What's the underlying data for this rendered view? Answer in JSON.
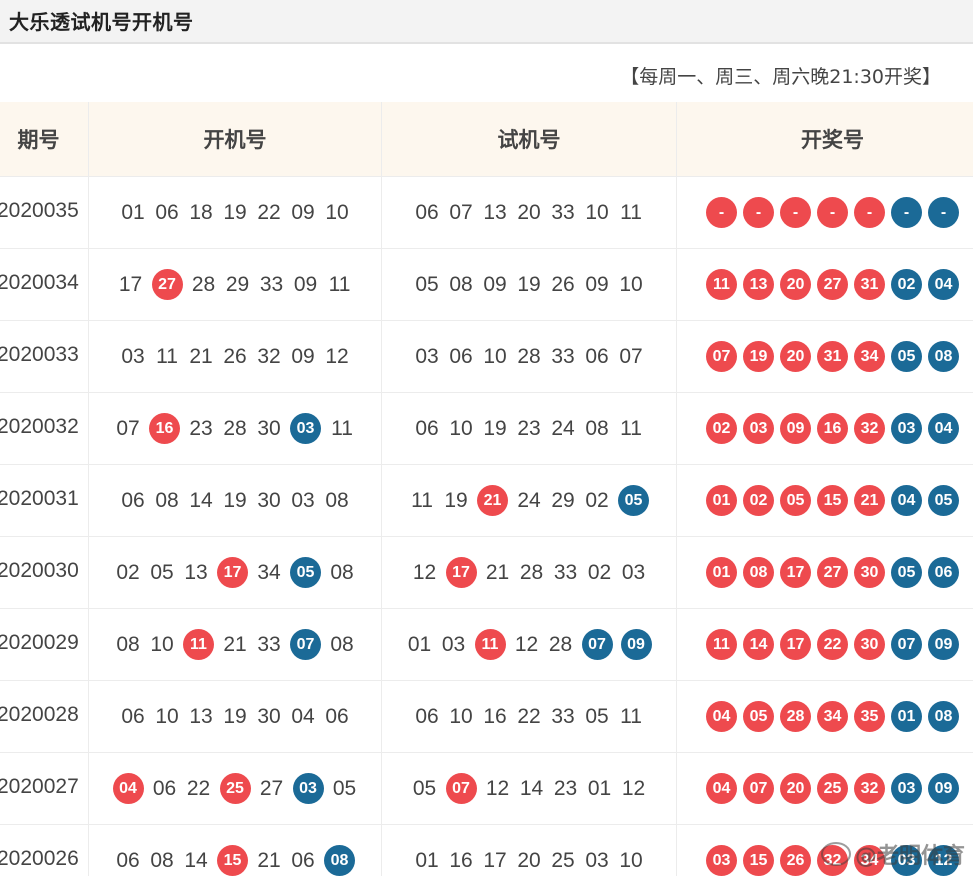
{
  "page": {
    "title": "大乐透试机号开机号",
    "schedule": "【每周一、周三、周六晚21:30开奖】",
    "watermark": "@老明体育"
  },
  "colors": {
    "red_ball": "#ee4a4e",
    "blue_ball": "#1b6a97",
    "header_bg": "#fdf7ee"
  },
  "table": {
    "headers": {
      "issue": "期号",
      "open": "开机号",
      "trial": "试机号",
      "draw": "开奖号"
    },
    "rows": [
      {
        "issue": "2020035",
        "open": [
          {
            "n": "01"
          },
          {
            "n": "06"
          },
          {
            "n": "18"
          },
          {
            "n": "19"
          },
          {
            "n": "22"
          },
          {
            "n": "09"
          },
          {
            "n": "10"
          }
        ],
        "trial": [
          {
            "n": "06"
          },
          {
            "n": "07"
          },
          {
            "n": "13"
          },
          {
            "n": "20"
          },
          {
            "n": "33"
          },
          {
            "n": "10"
          },
          {
            "n": "11"
          }
        ],
        "draw": [
          {
            "n": "-",
            "c": "red"
          },
          {
            "n": "-",
            "c": "red"
          },
          {
            "n": "-",
            "c": "red"
          },
          {
            "n": "-",
            "c": "red"
          },
          {
            "n": "-",
            "c": "red"
          },
          {
            "n": "-",
            "c": "blue"
          },
          {
            "n": "-",
            "c": "blue"
          }
        ]
      },
      {
        "issue": "2020034",
        "open": [
          {
            "n": "17"
          },
          {
            "n": "27",
            "c": "red"
          },
          {
            "n": "28"
          },
          {
            "n": "29"
          },
          {
            "n": "33"
          },
          {
            "n": "09"
          },
          {
            "n": "11"
          }
        ],
        "trial": [
          {
            "n": "05"
          },
          {
            "n": "08"
          },
          {
            "n": "09"
          },
          {
            "n": "19"
          },
          {
            "n": "26"
          },
          {
            "n": "09"
          },
          {
            "n": "10"
          }
        ],
        "draw": [
          {
            "n": "11",
            "c": "red"
          },
          {
            "n": "13",
            "c": "red"
          },
          {
            "n": "20",
            "c": "red"
          },
          {
            "n": "27",
            "c": "red"
          },
          {
            "n": "31",
            "c": "red"
          },
          {
            "n": "02",
            "c": "blue"
          },
          {
            "n": "04",
            "c": "blue"
          }
        ]
      },
      {
        "issue": "2020033",
        "open": [
          {
            "n": "03"
          },
          {
            "n": "11"
          },
          {
            "n": "21"
          },
          {
            "n": "26"
          },
          {
            "n": "32"
          },
          {
            "n": "09"
          },
          {
            "n": "12"
          }
        ],
        "trial": [
          {
            "n": "03"
          },
          {
            "n": "06"
          },
          {
            "n": "10"
          },
          {
            "n": "28"
          },
          {
            "n": "33"
          },
          {
            "n": "06"
          },
          {
            "n": "07"
          }
        ],
        "draw": [
          {
            "n": "07",
            "c": "red"
          },
          {
            "n": "19",
            "c": "red"
          },
          {
            "n": "20",
            "c": "red"
          },
          {
            "n": "31",
            "c": "red"
          },
          {
            "n": "34",
            "c": "red"
          },
          {
            "n": "05",
            "c": "blue"
          },
          {
            "n": "08",
            "c": "blue"
          }
        ]
      },
      {
        "issue": "2020032",
        "open": [
          {
            "n": "07"
          },
          {
            "n": "16",
            "c": "red"
          },
          {
            "n": "23"
          },
          {
            "n": "28"
          },
          {
            "n": "30"
          },
          {
            "n": "03",
            "c": "blue"
          },
          {
            "n": "11"
          }
        ],
        "trial": [
          {
            "n": "06"
          },
          {
            "n": "10"
          },
          {
            "n": "19"
          },
          {
            "n": "23"
          },
          {
            "n": "24"
          },
          {
            "n": "08"
          },
          {
            "n": "11"
          }
        ],
        "draw": [
          {
            "n": "02",
            "c": "red"
          },
          {
            "n": "03",
            "c": "red"
          },
          {
            "n": "09",
            "c": "red"
          },
          {
            "n": "16",
            "c": "red"
          },
          {
            "n": "32",
            "c": "red"
          },
          {
            "n": "03",
            "c": "blue"
          },
          {
            "n": "04",
            "c": "blue"
          }
        ]
      },
      {
        "issue": "2020031",
        "open": [
          {
            "n": "06"
          },
          {
            "n": "08"
          },
          {
            "n": "14"
          },
          {
            "n": "19"
          },
          {
            "n": "30"
          },
          {
            "n": "03"
          },
          {
            "n": "08"
          }
        ],
        "trial": [
          {
            "n": "11"
          },
          {
            "n": "19"
          },
          {
            "n": "21",
            "c": "red"
          },
          {
            "n": "24"
          },
          {
            "n": "29"
          },
          {
            "n": "02"
          },
          {
            "n": "05",
            "c": "blue"
          }
        ],
        "draw": [
          {
            "n": "01",
            "c": "red"
          },
          {
            "n": "02",
            "c": "red"
          },
          {
            "n": "05",
            "c": "red"
          },
          {
            "n": "15",
            "c": "red"
          },
          {
            "n": "21",
            "c": "red"
          },
          {
            "n": "04",
            "c": "blue"
          },
          {
            "n": "05",
            "c": "blue"
          }
        ]
      },
      {
        "issue": "2020030",
        "open": [
          {
            "n": "02"
          },
          {
            "n": "05"
          },
          {
            "n": "13"
          },
          {
            "n": "17",
            "c": "red"
          },
          {
            "n": "34"
          },
          {
            "n": "05",
            "c": "blue"
          },
          {
            "n": "08"
          }
        ],
        "trial": [
          {
            "n": "12"
          },
          {
            "n": "17",
            "c": "red"
          },
          {
            "n": "21"
          },
          {
            "n": "28"
          },
          {
            "n": "33"
          },
          {
            "n": "02"
          },
          {
            "n": "03"
          }
        ],
        "draw": [
          {
            "n": "01",
            "c": "red"
          },
          {
            "n": "08",
            "c": "red"
          },
          {
            "n": "17",
            "c": "red"
          },
          {
            "n": "27",
            "c": "red"
          },
          {
            "n": "30",
            "c": "red"
          },
          {
            "n": "05",
            "c": "blue"
          },
          {
            "n": "06",
            "c": "blue"
          }
        ]
      },
      {
        "issue": "2020029",
        "open": [
          {
            "n": "08"
          },
          {
            "n": "10"
          },
          {
            "n": "11",
            "c": "red"
          },
          {
            "n": "21"
          },
          {
            "n": "33"
          },
          {
            "n": "07",
            "c": "blue"
          },
          {
            "n": "08"
          }
        ],
        "trial": [
          {
            "n": "01"
          },
          {
            "n": "03"
          },
          {
            "n": "11",
            "c": "red"
          },
          {
            "n": "12"
          },
          {
            "n": "28"
          },
          {
            "n": "07",
            "c": "blue"
          },
          {
            "n": "09",
            "c": "blue"
          }
        ],
        "draw": [
          {
            "n": "11",
            "c": "red"
          },
          {
            "n": "14",
            "c": "red"
          },
          {
            "n": "17",
            "c": "red"
          },
          {
            "n": "22",
            "c": "red"
          },
          {
            "n": "30",
            "c": "red"
          },
          {
            "n": "07",
            "c": "blue"
          },
          {
            "n": "09",
            "c": "blue"
          }
        ]
      },
      {
        "issue": "2020028",
        "open": [
          {
            "n": "06"
          },
          {
            "n": "10"
          },
          {
            "n": "13"
          },
          {
            "n": "19"
          },
          {
            "n": "30"
          },
          {
            "n": "04"
          },
          {
            "n": "06"
          }
        ],
        "trial": [
          {
            "n": "06"
          },
          {
            "n": "10"
          },
          {
            "n": "16"
          },
          {
            "n": "22"
          },
          {
            "n": "33"
          },
          {
            "n": "05"
          },
          {
            "n": "11"
          }
        ],
        "draw": [
          {
            "n": "04",
            "c": "red"
          },
          {
            "n": "05",
            "c": "red"
          },
          {
            "n": "28",
            "c": "red"
          },
          {
            "n": "34",
            "c": "red"
          },
          {
            "n": "35",
            "c": "red"
          },
          {
            "n": "01",
            "c": "blue"
          },
          {
            "n": "08",
            "c": "blue"
          }
        ]
      },
      {
        "issue": "2020027",
        "open": [
          {
            "n": "04",
            "c": "red"
          },
          {
            "n": "06"
          },
          {
            "n": "22"
          },
          {
            "n": "25",
            "c": "red"
          },
          {
            "n": "27"
          },
          {
            "n": "03",
            "c": "blue"
          },
          {
            "n": "05"
          }
        ],
        "trial": [
          {
            "n": "05"
          },
          {
            "n": "07",
            "c": "red"
          },
          {
            "n": "12"
          },
          {
            "n": "14"
          },
          {
            "n": "23"
          },
          {
            "n": "01"
          },
          {
            "n": "12"
          }
        ],
        "draw": [
          {
            "n": "04",
            "c": "red"
          },
          {
            "n": "07",
            "c": "red"
          },
          {
            "n": "20",
            "c": "red"
          },
          {
            "n": "25",
            "c": "red"
          },
          {
            "n": "32",
            "c": "red"
          },
          {
            "n": "03",
            "c": "blue"
          },
          {
            "n": "09",
            "c": "blue"
          }
        ]
      },
      {
        "issue": "2020026",
        "open": [
          {
            "n": "06"
          },
          {
            "n": "08"
          },
          {
            "n": "14"
          },
          {
            "n": "15",
            "c": "red"
          },
          {
            "n": "21"
          },
          {
            "n": "06"
          },
          {
            "n": "08",
            "c": "blue"
          }
        ],
        "trial": [
          {
            "n": "01"
          },
          {
            "n": "16"
          },
          {
            "n": "17"
          },
          {
            "n": "20"
          },
          {
            "n": "25"
          },
          {
            "n": "03"
          },
          {
            "n": "10"
          }
        ],
        "draw": [
          {
            "n": "03",
            "c": "red"
          },
          {
            "n": "15",
            "c": "red"
          },
          {
            "n": "26",
            "c": "red"
          },
          {
            "n": "32",
            "c": "red"
          },
          {
            "n": "34",
            "c": "red"
          },
          {
            "n": "03",
            "c": "blue"
          },
          {
            "n": "12",
            "c": "blue"
          }
        ]
      }
    ]
  }
}
